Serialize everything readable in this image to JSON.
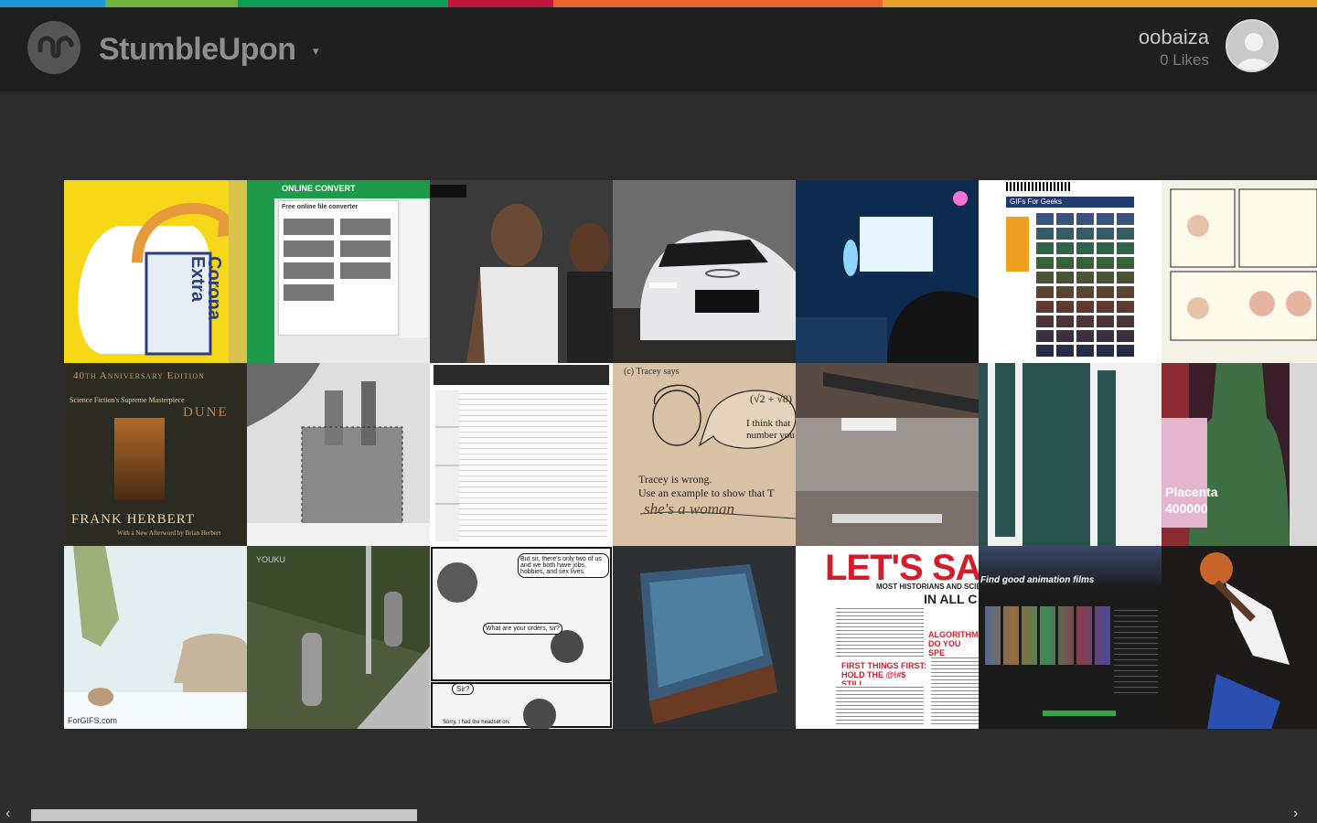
{
  "brand": {
    "name": "StumbleUpon",
    "caret": "▾"
  },
  "user": {
    "name": "oobaiza",
    "likes": "0 Likes"
  },
  "color_strip": [
    "#1d9ad6",
    "#6fb43f",
    "#0a9e53",
    "#c4163d",
    "#e8642c",
    "#e8a22c"
  ],
  "tiles": {
    "corona": {
      "label": "Corona\nExtra"
    },
    "convert": {
      "brand": "ONLINE CONVERT",
      "heading": "Free online file converter"
    },
    "dune": {
      "edition": "40th Anniversary Edition",
      "tagline": "Science Fiction's Supreme Masterpiece",
      "title": "DUNE",
      "author": "FRANK HERBERT",
      "note": "With a New Afterword by Brian Herbert"
    },
    "tracey": {
      "top": "(c)  Tracey says",
      "bubble": "I think that\nnumber you",
      "math": "(√2 + √8)",
      "line1": "Tracey is wrong.",
      "line2": "Use an example to show that T",
      "hand": "she's a woman"
    },
    "gifs_page": {
      "header": "GIFs For Geeks"
    },
    "forgifs": {
      "label": "ForGIFS.com"
    },
    "youku": {
      "label": "YOUKU"
    },
    "vikings": {
      "bubble1": "But sir, there's only two of us and we both have jobs, hobbies, and sex lives.",
      "bubble2": "What are your orders, sir?",
      "bubble3": "Sir?",
      "bubble4": "Sorry, I had the headset on."
    },
    "lets": {
      "title": "LET'S SA",
      "sub1": "MOST HISTORIANS AND SCIENT",
      "sub2": "IN ALL C",
      "h1": "ALGORITHMS DO YOU SPE",
      "h2": "FIRST THINGS FIRST: HOLD THE @!#$ STILL"
    },
    "animation": {
      "header": "Find good animation films"
    },
    "bottle": {
      "label": "Placenta\n400000"
    }
  },
  "scrollbar": {
    "left_arrow": "‹",
    "right_arrow": "›"
  }
}
